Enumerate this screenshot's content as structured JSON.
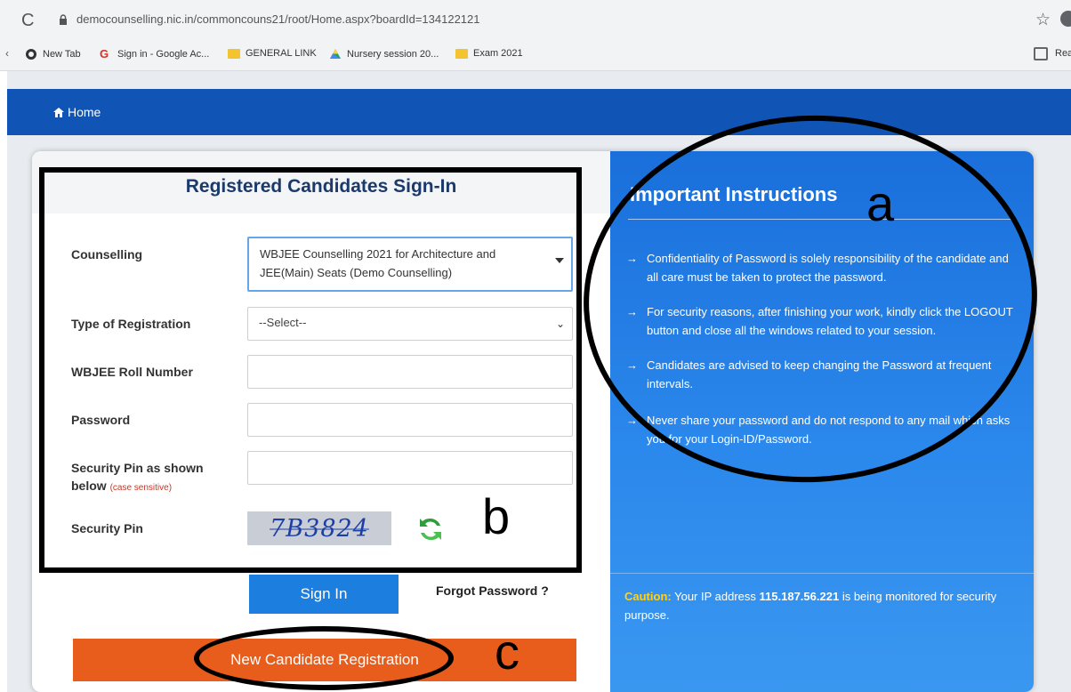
{
  "browser": {
    "url": "democounselling.nic.in/commoncouns21/root/Home.aspx?boardId=134122121",
    "bookmarks": [
      "New Tab",
      "Sign in - Google Ac...",
      "GENERAL LINK",
      "Nursery session 20...",
      "Exam 2021"
    ],
    "reading_list_label": "Rea"
  },
  "nav": {
    "home_label": "Home"
  },
  "form": {
    "title": "Registered Candidates Sign-In",
    "counselling_label": "Counselling",
    "counselling_value": "WBJEE Counselling 2021 for Architecture and JEE(Main) Seats (Demo Counselling)",
    "registration_label": "Type of Registration",
    "registration_value": "--Select--",
    "roll_label": "WBJEE Roll Number",
    "password_label": "Password",
    "pin_label": "Security Pin as shown below",
    "pin_note": "(case sensitive)",
    "captcha_label": "Security Pin",
    "captcha_text": "7B3824",
    "signin_label": "Sign In",
    "forgot_label": "Forgot Password ?",
    "new_registration_label": "New Candidate Registration"
  },
  "instructions": {
    "title": "Important Instructions",
    "items": [
      "Confidentiality of Password is solely responsibility of the candidate and all care must be taken to protect the password.",
      "For security reasons, after finishing your work, kindly click the LOGOUT button and close all the windows related to your session.",
      "Candidates are advised to keep changing the Password at frequent intervals.",
      "Never share your password and do not respond to any mail which asks you for your Login-ID/Password."
    ],
    "caution_word": "Caution:",
    "caution_pre": "Your IP address",
    "caution_ip": "115.187.56.221",
    "caution_post": "is being monitored for security purpose."
  },
  "annotations": {
    "a": "a",
    "b": "b",
    "c": "c"
  },
  "colors": {
    "navbar": "#1055b5",
    "signin": "#1c7fe0",
    "new_registration": "#e85d1c",
    "caution": "#ffd21e"
  }
}
